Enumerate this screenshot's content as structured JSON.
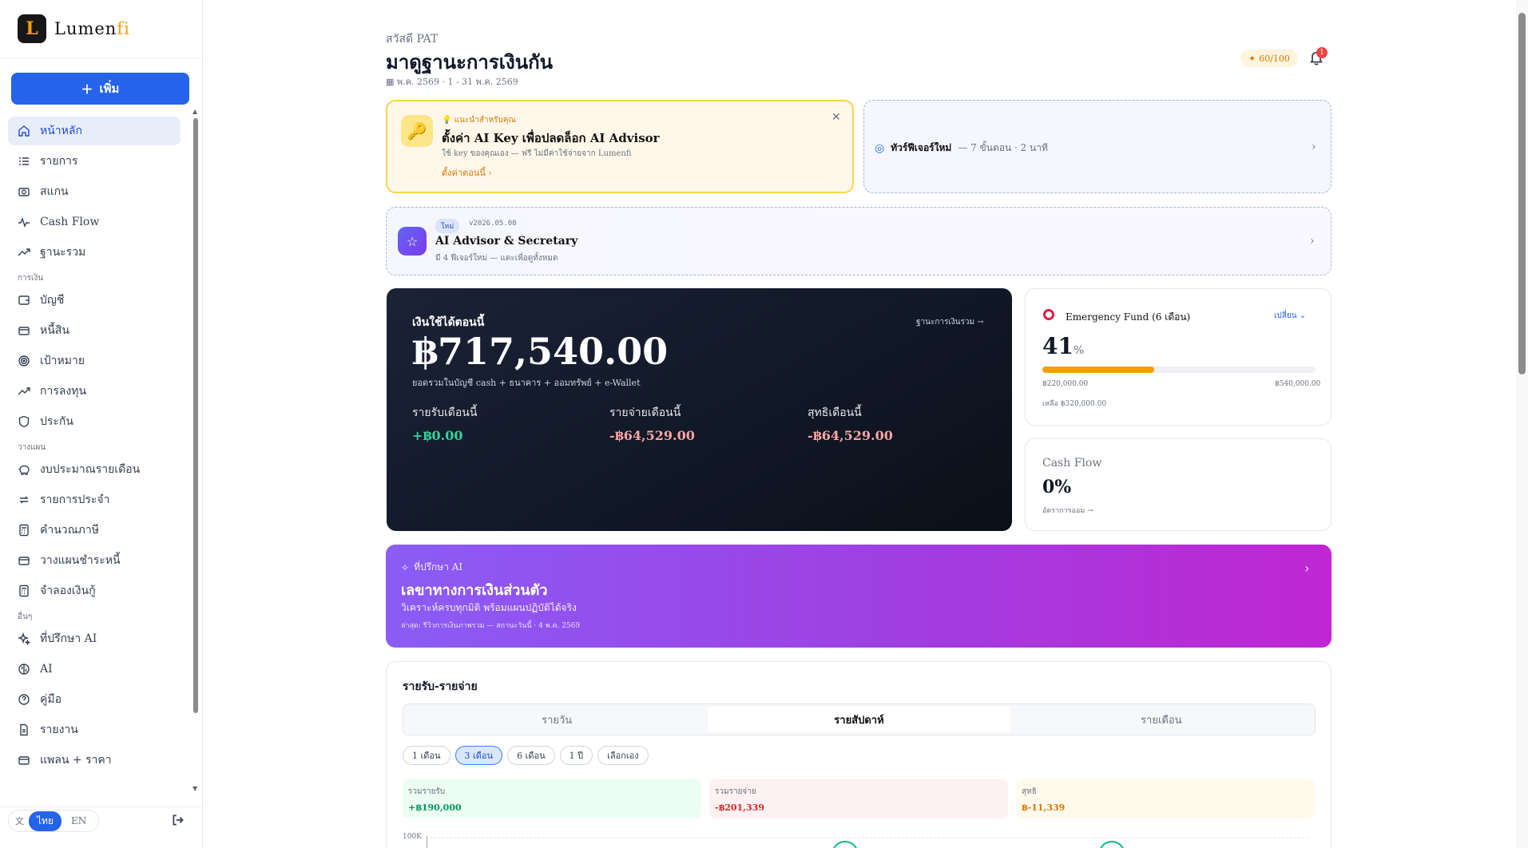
{
  "brand": {
    "logo_letter": "L",
    "name_main": "Lumen",
    "name_accent": "fi"
  },
  "sidebar": {
    "add_label": "เพิ่ม",
    "main_items": [
      {
        "label": "หน้าหลัก",
        "icon": "home-icon",
        "active": true
      },
      {
        "label": "รายการ",
        "icon": "list-icon"
      },
      {
        "label": "สแกน",
        "icon": "camera-icon"
      },
      {
        "label": "Cash Flow",
        "icon": "pulse-icon"
      },
      {
        "label": "ฐานะรวม",
        "icon": "trend-icon"
      }
    ],
    "section_finance": "การเงิน",
    "finance_items": [
      {
        "label": "บัญชี",
        "icon": "wallet-icon"
      },
      {
        "label": "หนี้สิน",
        "icon": "credit-card-icon"
      },
      {
        "label": "เป้าหมาย",
        "icon": "target-icon"
      },
      {
        "label": "การลงทุน",
        "icon": "trend-icon"
      },
      {
        "label": "ประกัน",
        "icon": "shield-icon"
      }
    ],
    "section_plan": "วางแผน",
    "plan_items": [
      {
        "label": "งบประมาณรายเดือน",
        "icon": "piggy-bank-icon"
      },
      {
        "label": "รายการประจำ",
        "icon": "repeat-icon"
      },
      {
        "label": "คำนวณภาษี",
        "icon": "calculator-icon"
      },
      {
        "label": "วางแผนชำระหนี้",
        "icon": "credit-card-icon"
      },
      {
        "label": "จำลองเงินกู้",
        "icon": "calculator-icon"
      }
    ],
    "section_other": "อื่นๆ",
    "other_items": [
      {
        "label": "ที่ปรึกษา AI",
        "icon": "sparkles-icon"
      },
      {
        "label": "AI",
        "icon": "brain-icon"
      },
      {
        "label": "คู่มือ",
        "icon": "help-icon"
      },
      {
        "label": "รายงาน",
        "icon": "document-icon"
      },
      {
        "label": "แพลน + ราคา",
        "icon": "credit-card-icon"
      }
    ],
    "lang_on": "ไทย",
    "lang_off": "EN"
  },
  "header": {
    "greeting": "สวัสดี PAT",
    "title": "มาดูฐานะการเงินกัน",
    "date_range": "พ.ค. 2569 · 1 - 31 พ.ค. 2569",
    "score": "60/100",
    "notif_count": "1"
  },
  "ai_key_card": {
    "kicker": "แนะนำสำหรับคุณ",
    "title": "ตั้งค่า AI Key เพื่อปลดล็อก AI Advisor",
    "desc": "ใช้ key ของคุณเอง — ฟรี ไม่มีค่าใช้จ่ายจาก Lumenfi",
    "link": "ตั้งค่าตอนนี้"
  },
  "tour_card": {
    "title": "ทัวร์ฟีเจอร์ใหม่",
    "meta": "— 7 ขั้นตอน · 2 นาที"
  },
  "whats_new": {
    "badge": "ใหม่",
    "version": "v2026.05.08",
    "title": "AI Advisor & Secretary",
    "desc": "มี 4 ฟีเจอร์ใหม่ — แตะเพื่อดูทั้งหมด"
  },
  "balance_card": {
    "label": "เงินใช้ได้ตอนนี้",
    "link": "ฐานะการเงินรวม →",
    "amount": "฿717,540.00",
    "subtitle": "ยอดรวมในบัญชี cash + ธนาคาร + ออมทรัพย์ + e-Wallet",
    "income_label": "รายรับเดือนนี้",
    "income_value": "+฿0.00",
    "expense_label": "รายจ่ายเดือนนี้",
    "expense_value": "-฿64,529.00",
    "net_label": "สุทธิเดือนนี้",
    "net_value": "-฿64,529.00"
  },
  "emergency_fund": {
    "title": "Emergency Fund (6 เดือน)",
    "change": "เปลี่ยน",
    "percent": "41",
    "percent_unit": "%",
    "progress": 0.41,
    "current": "฿220,000.00",
    "target": "฿540,000.00",
    "remaining": "เหลือ ฿320,000.00"
  },
  "cash_flow": {
    "title": "Cash Flow",
    "value": "0%",
    "link": "อัตราการออม →"
  },
  "advisor_banner": {
    "kicker": "ที่ปรึกษา AI",
    "title": "เลขาทางการเงินส่วนตัว",
    "desc": "วิเคราะห์ครบทุกมิติ พร้อมแผนปฏิบัติได้จริง",
    "meta": "ล่าสุด: รีวิวการเงินภาพรวม — สถานะวันนี้ · 4 พ.ค. 2569"
  },
  "income_expense": {
    "title": "รายรับ-รายจ่าย",
    "tabs": [
      "รายวัน",
      "รายสัปดาห์",
      "รายเดือน"
    ],
    "active_tab": 1,
    "ranges": [
      "1 เดือน",
      "3 เดือน",
      "6 เดือน",
      "1 ปี",
      "เลือกเอง"
    ],
    "active_range": 1,
    "total_income_label": "รวมรายรับ",
    "total_income": "+฿190,000",
    "total_expense_label": "รวมรายจ่าย",
    "total_expense": "-฿201,339",
    "net_label": "สุทธิ",
    "net": "฿-11,339",
    "axis_top": "100K"
  }
}
